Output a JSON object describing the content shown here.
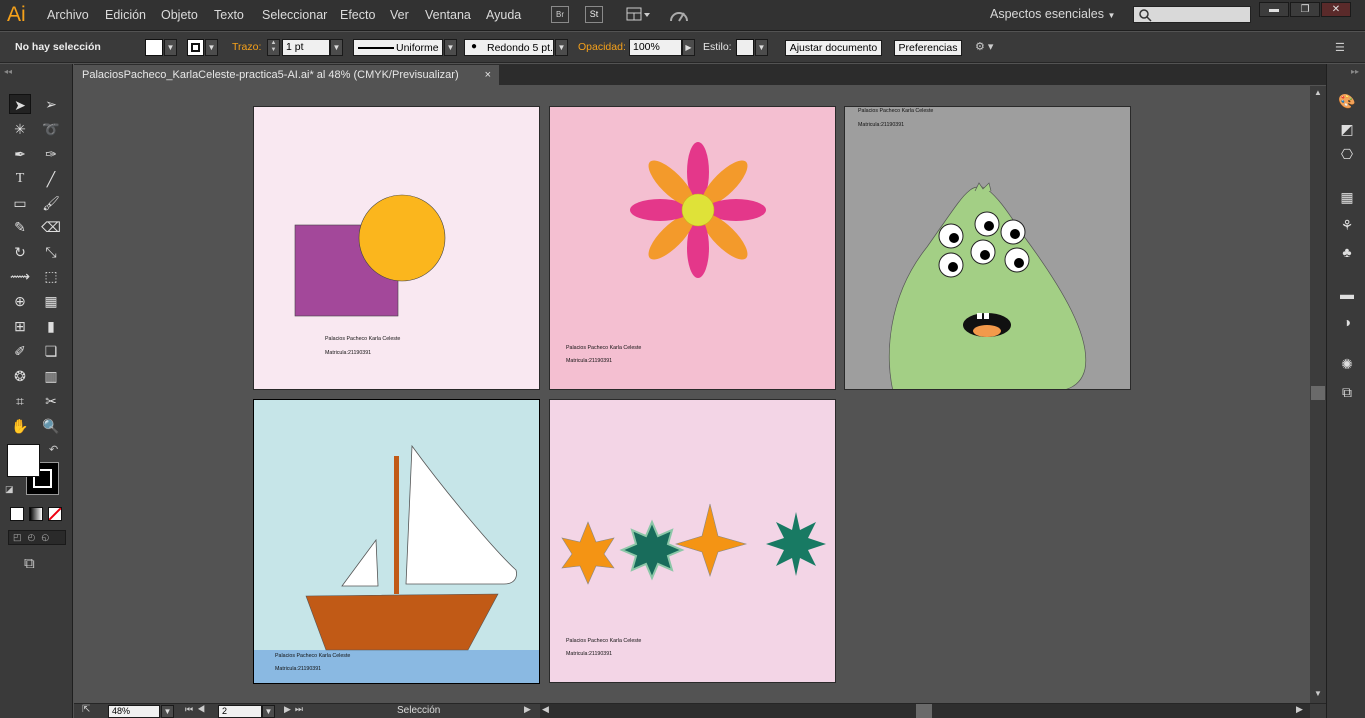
{
  "app": {
    "logo": "Ai",
    "workspace": "Aspectos esenciales",
    "bridge_label": "Br",
    "stock_label": "St"
  },
  "menu": [
    "Archivo",
    "Edición",
    "Objeto",
    "Texto",
    "Seleccionar",
    "Efecto",
    "Ver",
    "Ventana",
    "Ayuda"
  ],
  "control": {
    "selection": "No hay selección",
    "stroke_label": "Trazo:",
    "stroke_weight": "1 pt",
    "profile": "Uniforme",
    "brush": "Redondo 5 pt.",
    "opacity_label": "Opacidad:",
    "opacity": "100%",
    "style_label": "Estilo:",
    "fit_button": "Ajustar documento",
    "prefs_button": "Preferencias"
  },
  "document": {
    "tab_title": "PalaciosPacheco_KarlaCeleste-practica5-AI.ai* al 48% (CMYK/Previsualizar)"
  },
  "artboards": {
    "name_line": "Palacios Pacheco Karla Celeste",
    "id_line": "Matricula:21190391"
  },
  "status": {
    "zoom": "48%",
    "page": "2",
    "mode": "Selección"
  },
  "colors": {
    "menubar": "#323232",
    "panel": "#3a3a3a",
    "canvas": "#535353",
    "accent": "#f6a11a"
  }
}
